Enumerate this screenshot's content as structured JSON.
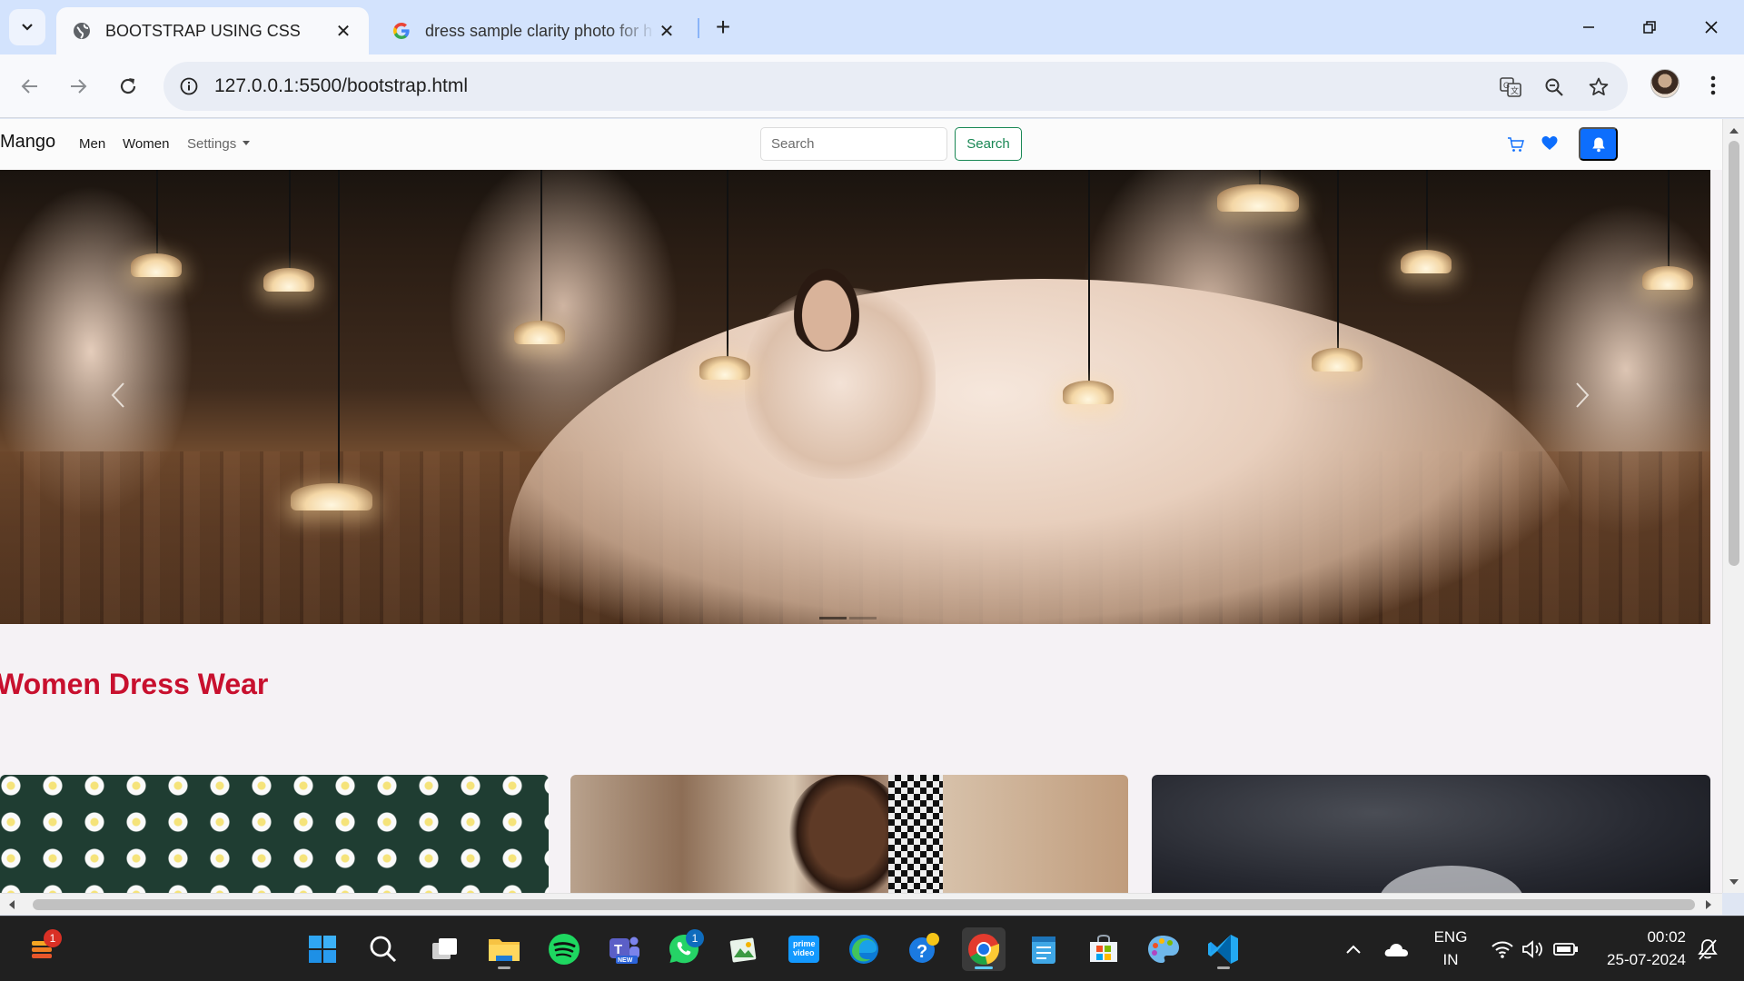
{
  "browser": {
    "tabs": [
      {
        "title": "BOOTSTRAP USING CSS",
        "active": true
      },
      {
        "title": "dress sample clarity photo for h",
        "active": false
      }
    ],
    "url": "127.0.0.1:5500/bootstrap.html"
  },
  "site": {
    "brand": "Mango",
    "nav": {
      "men": "Men",
      "women": "Women",
      "settings": "Settings"
    },
    "search": {
      "placeholder": "Search",
      "button": "Search"
    },
    "section_title": "Women Dress Wear",
    "carousel": {
      "slides": 2,
      "active_slide": 1
    },
    "colors": {
      "primary": "#0d6efd",
      "success": "#198754",
      "heading": "#c8102e"
    }
  },
  "taskbar": {
    "apps": [
      {
        "name": "start",
        "icon": "windows-icon"
      },
      {
        "name": "search",
        "icon": "search-icon"
      },
      {
        "name": "task-view",
        "icon": "task-view-icon"
      },
      {
        "name": "file-explorer",
        "icon": "folder-icon"
      },
      {
        "name": "spotify",
        "icon": "spotify-icon"
      },
      {
        "name": "teams",
        "icon": "teams-icon"
      },
      {
        "name": "whatsapp",
        "icon": "whatsapp-icon",
        "badge": "1"
      },
      {
        "name": "photos",
        "icon": "photos-icon"
      },
      {
        "name": "prime-video",
        "icon": "prime-video-icon"
      },
      {
        "name": "edge",
        "icon": "edge-icon"
      },
      {
        "name": "get-help",
        "icon": "help-icon"
      },
      {
        "name": "chrome",
        "icon": "chrome-icon",
        "active": true
      },
      {
        "name": "notepad",
        "icon": "notepad-icon"
      },
      {
        "name": "microsoft-store",
        "icon": "store-icon"
      },
      {
        "name": "paint",
        "icon": "paint-icon"
      },
      {
        "name": "vscode",
        "icon": "vscode-icon"
      }
    ],
    "widget_badge": "1",
    "lang_line1": "ENG",
    "lang_line2": "IN",
    "time": "00:02",
    "date": "25-07-2024"
  }
}
